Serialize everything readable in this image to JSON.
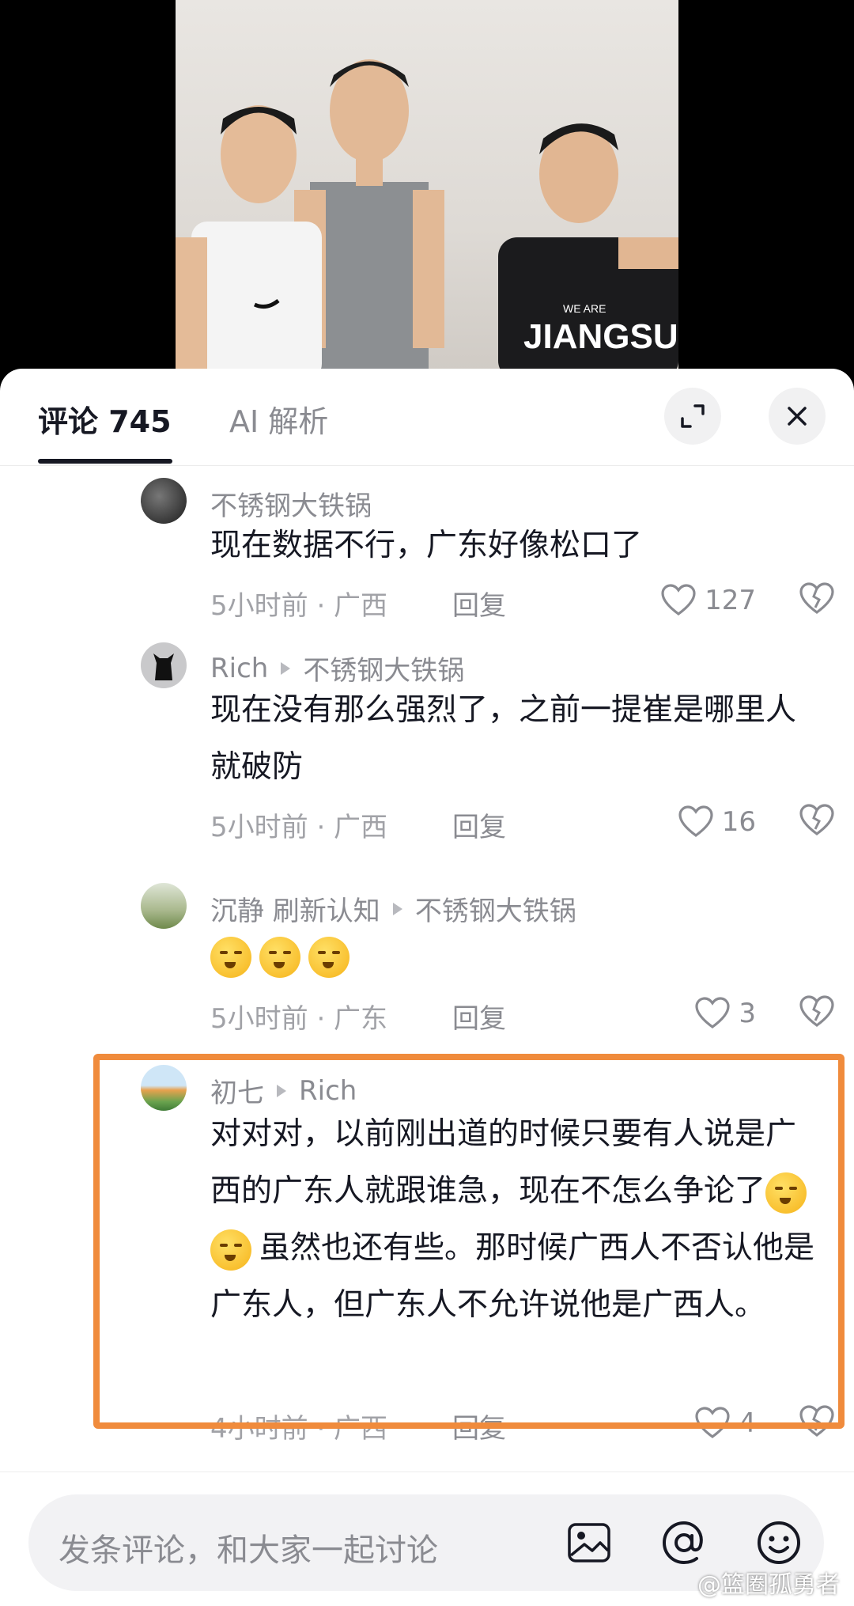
{
  "header": {
    "tab_comments": "评论 745",
    "tab_ai": "AI 解析"
  },
  "comments": [
    {
      "author": "不锈钢大铁锅",
      "reply_to": "",
      "text": "现在数据不行，广东好像松口了",
      "time_location": "5小时前 · 广西",
      "reply_label": "回复",
      "likes": "127"
    },
    {
      "author": "Rich",
      "reply_to": "不锈钢大铁锅",
      "text": "现在没有那么强烈了，之前一提崔是哪里人就破防",
      "time_location": "5小时前 · 广西",
      "reply_label": "回复",
      "likes": "16"
    },
    {
      "author": "沉静 刷新认知",
      "reply_to": "不锈钢大铁锅",
      "text": "",
      "time_location": "5小时前 · 广东",
      "reply_label": "回复",
      "likes": "3"
    },
    {
      "author": "初七",
      "reply_to": "Rich",
      "text_part1": "对对对，以前刚出道的时候只要有人说是广西的广东人就跟谁急，现在不怎么争论了",
      "text_part2": "虽然也还有些。那时候广西人不否认他是广东人，但广东人不允许说他是广西人。",
      "time_location": "4小时前 · 广西",
      "reply_label": "回复",
      "likes": "4"
    }
  ],
  "composer": {
    "placeholder": "发条评论，和大家一起讨论"
  },
  "watermark": "@篮圈孤勇者",
  "colors": {
    "highlight_border": "#f08b3c",
    "text_primary": "#161823",
    "text_secondary": "#8a8b91"
  },
  "icons": [
    "expand-icon",
    "close-icon",
    "heart-icon",
    "dislike-icon",
    "image-icon",
    "at-icon",
    "emoji-icon"
  ]
}
